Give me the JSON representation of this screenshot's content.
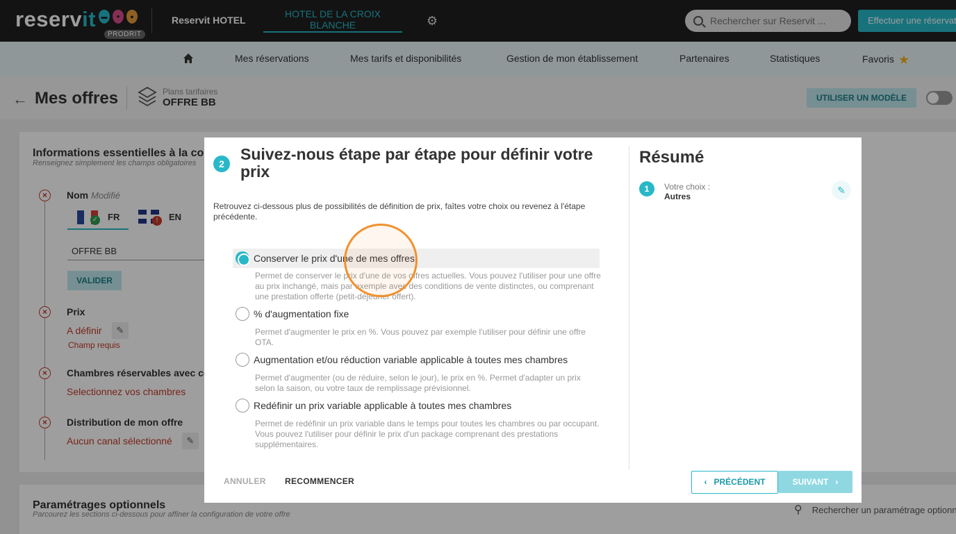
{
  "topbar": {
    "logo_main": "reserv",
    "logo_accent": "it",
    "env_badge": "PRODRIT",
    "hotel_name": "Reservit HOTEL",
    "hotel_tab": "HOTEL DE LA CROIX BLANCHE",
    "search_placeholder": "Rechercher sur Reservit ...",
    "booking_button": "Effectuer une réservation"
  },
  "nav": {
    "items": [
      "Mes réservations",
      "Mes tarifs et disponibilités",
      "Gestion de mon établissement",
      "Partenaires",
      "Statistiques",
      "Favoris"
    ]
  },
  "page_header": {
    "title": "Mes offres",
    "plans_label": "Plans tarifaires",
    "plans_value": "OFFRE BB",
    "model_button": "UTILISER UN MODÈLE"
  },
  "background_form": {
    "section_title": "Informations essentielles à la configuration",
    "section_sub": "Renseignez simplement les champs obligatoires",
    "nom_label": "Nom",
    "nom_modified": "Modifié",
    "lang_fr": "FR",
    "lang_en": "EN",
    "nom_value": "OFFRE BB",
    "valider": "VALIDER",
    "prix_label": "Prix",
    "prix_value": "A définir",
    "prix_required": "Champ requis",
    "chambres_label": "Chambres réservables avec cette offre",
    "chambres_value": "Selectionnez vos chambres",
    "distribution_label": "Distribution de mon offre",
    "distribution_value": "Aucun canal sélectionné",
    "optional_title": "Paramétrages optionnels",
    "optional_sub": "Parcourez les sections ci-dessous pour affiner la configuration de votre offre",
    "optional_search": "Rechercher un paramétrage optionnel"
  },
  "modal": {
    "step": "2",
    "title": "Suivez-nous étape par étape pour définir votre prix",
    "description": "Retrouvez ci-dessous plus de possibilités de définition de prix, faîtes votre choix ou revenez à l'étape précédente.",
    "options": [
      {
        "label": "Conserver le prix d'une de mes offres",
        "desc": "Permet de conserver le prix d'une de vos offres actuelles. Vous pouvez l'utiliser pour une offre au prix inchangé, mais par exemple avec des conditions de vente distinctes, ou comprenant une prestation offerte (petit-déjeuner offert).",
        "selected": true
      },
      {
        "label": "% d'augmentation fixe",
        "desc": "Permet d'augmenter le prix en %. Vous pouvez par exemple l'utiliser pour définir une offre OTA.",
        "selected": false
      },
      {
        "label": "Augmentation et/ou réduction variable applicable à toutes mes chambres",
        "desc": "Permet d'augmenter (ou de réduire, selon le jour), le prix en %. Permet d'adapter un prix selon la saison, ou votre taux de remplissage prévisionnel.",
        "selected": false
      },
      {
        "label": "Redéfinir un prix variable applicable à toutes mes chambres",
        "desc": "Permet de redéfinir un prix variable dans le temps pour toutes les chambres ou par occupant. Vous pouvez l'utiliser pour définir le prix d'un package comprenant des prestations supplémentaires.",
        "selected": false
      }
    ],
    "summary": {
      "title": "Résumé",
      "step": "1",
      "choice_label": "Votre choix :",
      "choice_value": "Autres"
    },
    "buttons": {
      "cancel": "ANNULER",
      "restart": "RECOMMENCER",
      "previous": "PRÉCÉDENT",
      "next": "SUIVANT"
    }
  },
  "colors": {
    "accent": "#28b8c8",
    "error": "#c0392b",
    "highlight_ring": "#f0912e"
  }
}
